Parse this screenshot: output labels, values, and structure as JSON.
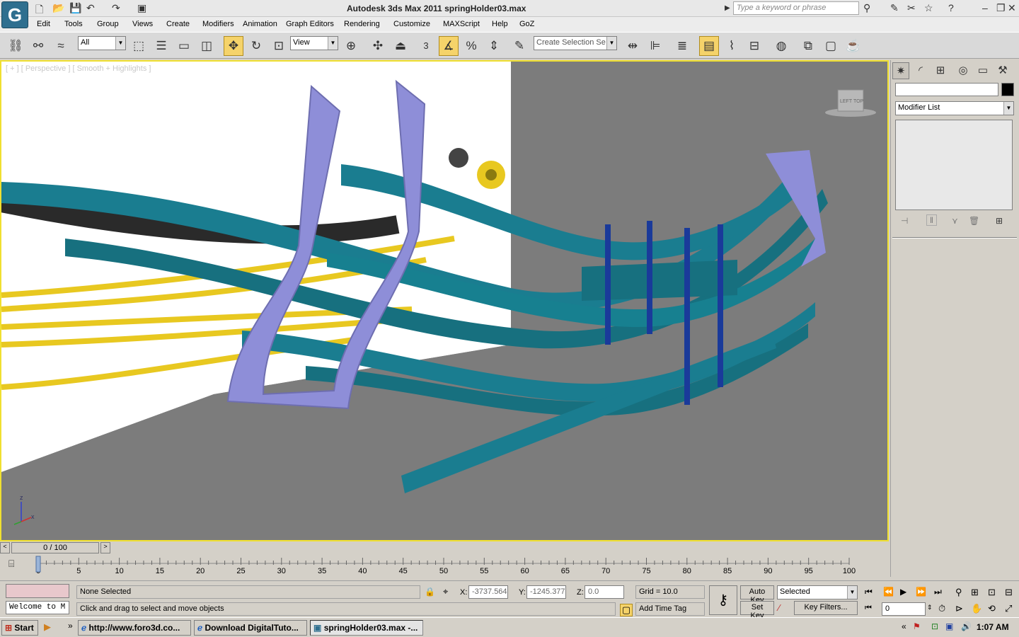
{
  "app": {
    "title": "Autodesk 3ds Max  2011     springHolder03.max",
    "search_placeholder": "Type a keyword or phrase",
    "logo": "G"
  },
  "menu": [
    "Edit",
    "Tools",
    "Group",
    "Views",
    "Create",
    "Modifiers",
    "Animation",
    "Graph Editors",
    "Rendering",
    "Customize",
    "MAXScript",
    "Help",
    "GoZ"
  ],
  "toolbar": {
    "filter_value": "All",
    "refcoord_value": "View",
    "selection_set_placeholder": "Create Selection Se",
    "snap_value": "3"
  },
  "viewport": {
    "label": "[ + ] [ Perspective ] [ Smooth + Highlights ]",
    "viewcube_left": "LEFT",
    "viewcube_top": "TOP",
    "axis_z": "z",
    "axis_x": "x",
    "colors": {
      "spring": "#1a7d90",
      "bracket": "#8e8ed8",
      "background_wall": "#ffffff",
      "yellow": "#e8c820",
      "bg": "#7c7c7c"
    }
  },
  "command_panel": {
    "modifier_list": "Modifier List"
  },
  "timeslider": {
    "value": "0 / 100",
    "ticks": [
      "0",
      "5",
      "10",
      "15",
      "20",
      "25",
      "30",
      "35",
      "40",
      "45",
      "50",
      "55",
      "60",
      "65",
      "70",
      "75",
      "80",
      "85",
      "90",
      "95",
      "100"
    ]
  },
  "status": {
    "maxscript_listener": "Welcome to M",
    "selection": "None Selected",
    "prompt": "Click and drag to select and move objects",
    "x_label": "X:",
    "x_value": "-3737.564",
    "y_label": "Y:",
    "y_value": "-1245.377",
    "z_label": "Z:",
    "z_value": "0.0",
    "grid": "Grid = 10.0",
    "add_time_tag": "Add Time Tag",
    "auto_key": "Auto Key",
    "set_key": "Set Key",
    "key_mode": "Selected",
    "key_filters": "Key Filters...",
    "frame": "0"
  },
  "taskbar": {
    "start": "Start",
    "tasks": [
      "http://www.foro3d.co...",
      "Download DigitalTuto...",
      "springHolder03.max -..."
    ],
    "clock": "1:07 AM"
  }
}
